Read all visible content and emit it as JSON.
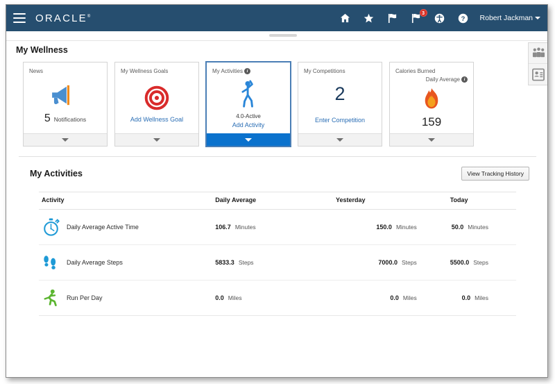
{
  "header": {
    "brand": "ORACLE",
    "menu_icon": "hamburger-icon",
    "icons": [
      {
        "name": "home-icon",
        "label": "Home"
      },
      {
        "name": "favorites-star-icon",
        "label": "Favorites"
      },
      {
        "name": "flag-icon",
        "label": "Watchlist"
      },
      {
        "name": "notifications-flag-icon",
        "label": "Notifications",
        "badge": "3"
      },
      {
        "name": "accessibility-icon",
        "label": "Settings and Actions"
      },
      {
        "name": "help-icon",
        "label": "Help"
      }
    ],
    "user": "Robert Jackman"
  },
  "page": {
    "title": "My Wellness"
  },
  "cards": [
    {
      "title": "News",
      "icon": "megaphone-icon",
      "value": "5",
      "value_label": "Notifications",
      "footer_icon": "chevron-down-icon",
      "active": false
    },
    {
      "title": "My Wellness Goals",
      "icon": "target-bullseye-icon",
      "link": "Add Wellness Goal",
      "footer_icon": "chevron-down-icon",
      "active": false
    },
    {
      "title": "My Activities",
      "has_info": true,
      "icon": "person-stretching-icon",
      "sub": "4.0-Active",
      "link": "Add Activity",
      "footer_icon": "chevron-down-icon",
      "active": true
    },
    {
      "title": "My Competitions",
      "big_value": "2",
      "link": "Enter Competition",
      "footer_icon": "chevron-down-icon",
      "active": false
    },
    {
      "title": "Calories Burned",
      "title2": "Daily Average",
      "has_info": true,
      "icon": "flame-icon",
      "value": "159",
      "footer_icon": "chevron-down-icon",
      "active": false
    }
  ],
  "activities_panel": {
    "title": "My Activities",
    "button": "View Tracking History",
    "columns": [
      "Activity",
      "Daily Average",
      "Yesterday",
      "Today"
    ],
    "rows": [
      {
        "icon": "stopwatch-icon",
        "name": "Daily Average Active Time",
        "average_value": "106.7",
        "average_unit": "Minutes",
        "yesterday_value": "150.0",
        "yesterday_unit": "Minutes",
        "today_value": "50.0",
        "today_unit": "Minutes"
      },
      {
        "icon": "footprints-icon",
        "name": "Daily Average Steps",
        "average_value": "5833.3",
        "average_unit": "Steps",
        "yesterday_value": "7000.0",
        "yesterday_unit": "Steps",
        "today_value": "5500.0",
        "today_unit": "Steps"
      },
      {
        "icon": "runner-icon",
        "name": "Run Per Day",
        "average_value": "0.0",
        "average_unit": "Miles",
        "yesterday_value": "0.0",
        "yesterday_unit": "Miles",
        "today_value": "0.0",
        "today_unit": "Miles"
      }
    ]
  },
  "side_dock": [
    {
      "name": "people-group-icon"
    },
    {
      "name": "contact-card-icon"
    }
  ],
  "colors": {
    "header_bg": "#264e6f",
    "accent_blue": "#0b72cd",
    "link_blue": "#2a6eb5",
    "badge_red": "#d93025",
    "target_red": "#d92b2b",
    "flame_orange": "#f07f1a",
    "runner_green": "#5cb531"
  }
}
